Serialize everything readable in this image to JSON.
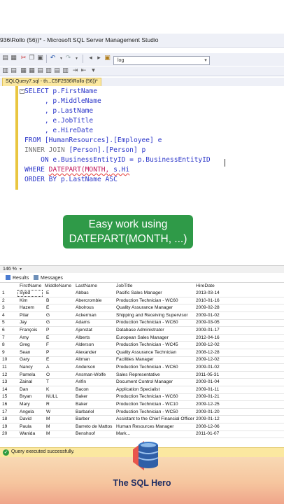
{
  "window": {
    "title": "936\\Rollo (56))* - Microsoft SQL Server Management Studio"
  },
  "toolbar": {
    "search_value": "log"
  },
  "editor_tab": {
    "label": "SQLQuery7.sql - th...C5F2936\\Rollo (56))*"
  },
  "query": {
    "line1": "SELECT p.FirstName",
    "line2": "     , p.MiddleName",
    "line3": "     , p.LastName",
    "line4": "     , e.JobTitle",
    "line5": "     , e.HireDate",
    "line6_kw": "FROM",
    "line6_rest": " [HumanResources].[Employee] e",
    "line7_kw": "INNER JOIN",
    "line7_rest": " [Person].[Person] p",
    "line8_kw": "    ON",
    "line8_rest": " e.BusinessEntityID = p.BusinessEntityID",
    "line9_kw": "WHERE",
    "line9_fn": "DATEPART(MONTH,",
    "line9_rest": " s.Hi",
    "line10_kw": "ORDER BY",
    "line10_rest": " p.LastName ASC"
  },
  "overlay": {
    "line1": "Easy work using",
    "line2": "DATEPART(MONTH, ...)"
  },
  "zoom": {
    "level": "146 %"
  },
  "results_tabs": {
    "results": "Results",
    "messages": "Messages"
  },
  "grid": {
    "columns": [
      "FirstName",
      "MiddleName",
      "LastName",
      "JobTitle",
      "HireDate"
    ],
    "rows": [
      [
        "1",
        "Syed",
        "E",
        "Abbas",
        "Pacific Sales Manager",
        "2013-03-14"
      ],
      [
        "2",
        "Kim",
        "B",
        "Abercrombie",
        "Production Technician - WC60",
        "2010-01-16"
      ],
      [
        "3",
        "Hazem",
        "E",
        "Abolrous",
        "Quality Assurance Manager",
        "2009-02-28"
      ],
      [
        "4",
        "Pilar",
        "G",
        "Ackerman",
        "Shipping and Receiving Supervisor",
        "2009-01-02"
      ],
      [
        "5",
        "Jay",
        "G",
        "Adams",
        "Production Technician - WC60",
        "2009-03-05"
      ],
      [
        "6",
        "François",
        "P",
        "Ajenstat",
        "Database Administrator",
        "2009-01-17"
      ],
      [
        "7",
        "Amy",
        "E",
        "Alberts",
        "European Sales Manager",
        "2012-04-16"
      ],
      [
        "8",
        "Greg",
        "F",
        "Alderson",
        "Production Technician - WC45",
        "2008-12-02"
      ],
      [
        "9",
        "Sean",
        "P",
        "Alexander",
        "Quality Assurance Technician",
        "2008-12-28"
      ],
      [
        "10",
        "Gary",
        "E",
        "Altman",
        "Facilities Manager",
        "2009-12-02"
      ],
      [
        "11",
        "Nancy",
        "A",
        "Anderson",
        "Production Technician - WC60",
        "2009-01-02"
      ],
      [
        "12",
        "Pamela",
        "O",
        "Ansman-Wolfe",
        "Sales Representative",
        "2011-05-31"
      ],
      [
        "13",
        "Zainal",
        "T",
        "Arifin",
        "Document Control Manager",
        "2009-01-04"
      ],
      [
        "14",
        "Dan",
        "K",
        "Bacon",
        "Application Specialist",
        "2009-01-11"
      ],
      [
        "15",
        "Bryan",
        "NULL",
        "Baker",
        "Production Technician - WC60",
        "2009-01-21"
      ],
      [
        "16",
        "Mary",
        "R",
        "Baker",
        "Production Technician - WC10",
        "2009-12-25"
      ],
      [
        "17",
        "Angela",
        "W",
        "Barbariol",
        "Production Technician - WC50",
        "2009-01-20"
      ],
      [
        "18",
        "David",
        "M",
        "Barber",
        "Assistant to the Chief Financial Officer",
        "2009-01-12"
      ],
      [
        "19",
        "Paula",
        "M",
        "Barreto de Mattos",
        "Human Resources Manager",
        "2008-12-06"
      ],
      [
        "20",
        "Wanida",
        "M",
        "Benshoof",
        "Mark...",
        "2011-01-07"
      ]
    ]
  },
  "status": {
    "message": "Query executed successfully."
  },
  "branding": {
    "logo_text": "The SQL Hero"
  },
  "colors": {
    "keyword": "#2b36c9",
    "overlay_green": "#2f9a48",
    "status_yellow": "#fbe8a0",
    "logo_navy": "#1f2d63"
  }
}
